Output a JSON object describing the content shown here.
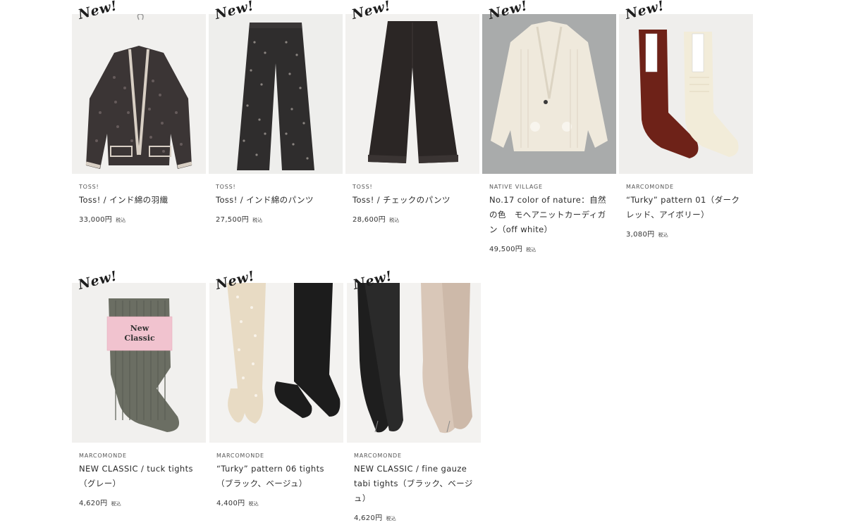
{
  "badge_label": "New!",
  "tax_label": "税込",
  "products": [
    {
      "brand": "Toss!",
      "name": "Toss! / インド綿の羽織",
      "price": "33,000円",
      "icon": "jacket-image"
    },
    {
      "brand": "Toss!",
      "name": "Toss! / インド綿のパンツ",
      "price": "27,500円",
      "icon": "patterned-pants-image"
    },
    {
      "brand": "Toss!",
      "name": "Toss! / チェックのパンツ",
      "price": "28,600円",
      "icon": "dark-pants-image"
    },
    {
      "brand": "NATIVE VILLAGE",
      "name": "No.17 color of nature：自然の色　モヘアニットカーディガン（off white）",
      "price": "49,500円",
      "icon": "cardigan-image"
    },
    {
      "brand": "MARCOMONDE",
      "name": "“Turky” pattern 01（ダークレッド、アイボリー）",
      "price": "3,080円",
      "icon": "socks-image"
    },
    {
      "brand": "MARCOMONDE",
      "name": "NEW CLASSIC / tuck tights（グレー）",
      "price": "4,620円",
      "icon": "tuck-tights-image"
    },
    {
      "brand": "MARCOMONDE",
      "name": "“Turky” pattern 06 tights（ブラック、ベージュ）",
      "price": "4,400円",
      "icon": "pattern-tights-image"
    },
    {
      "brand": "MARCOMONDE",
      "name": "NEW CLASSIC / fine gauze tabi tights（ブラック、ベージュ）",
      "price": "4,620円",
      "icon": "tabi-tights-image"
    }
  ]
}
